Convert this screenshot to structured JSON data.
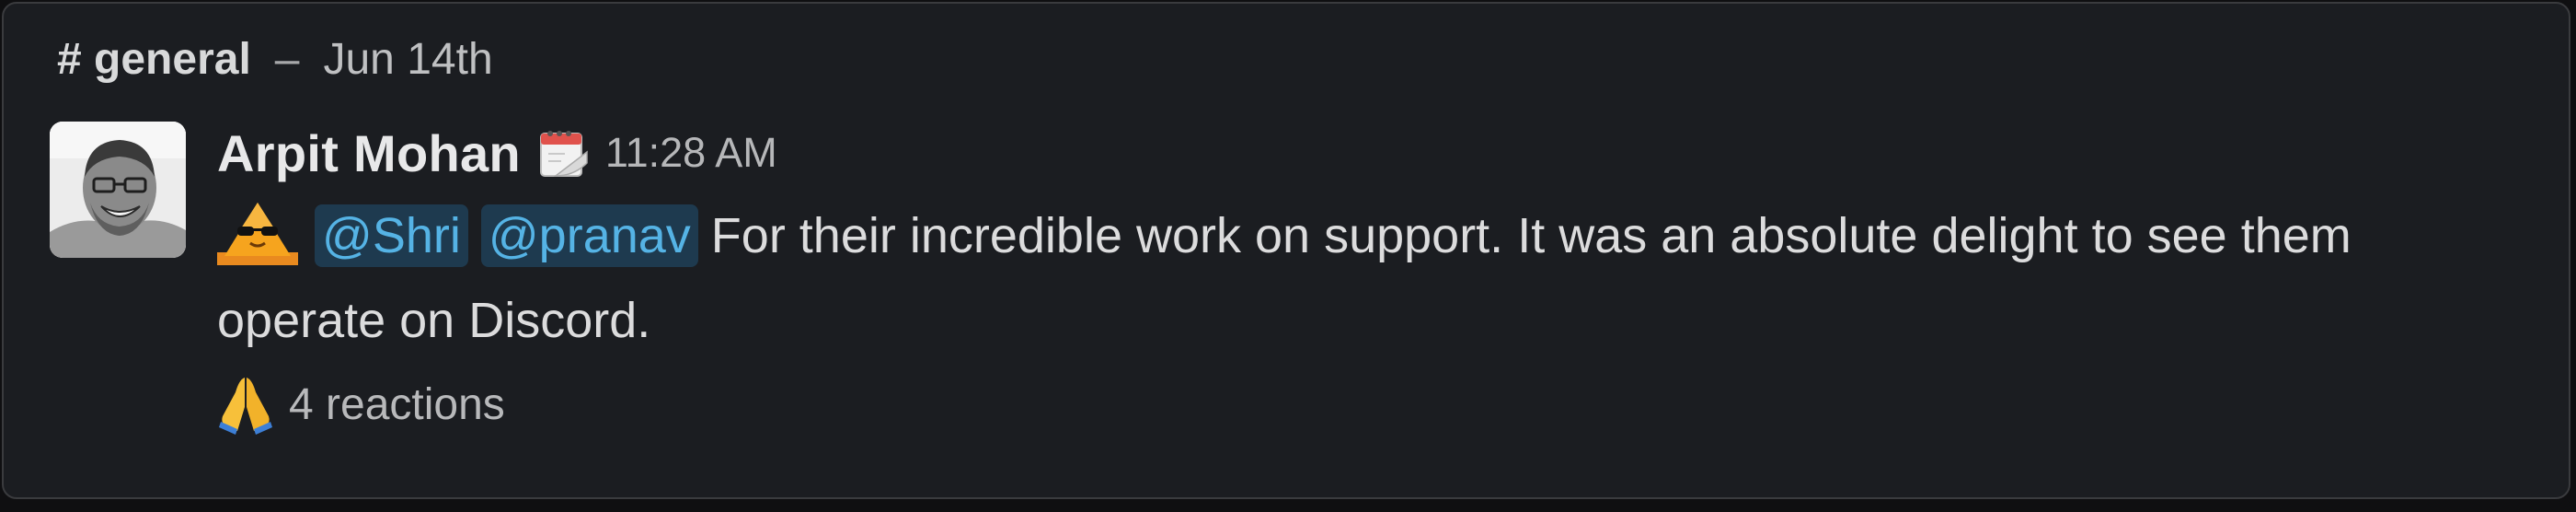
{
  "header": {
    "channel": "# general",
    "separator": "–",
    "date": "Jun 14th"
  },
  "message": {
    "author": "Arpit Mohan",
    "status_icon": "calendar-icon",
    "time": "11:28 AM",
    "custom_emoji": "party-cone-sunglasses-emoji",
    "mentions": [
      "@Shri",
      "@pranav"
    ],
    "text": "For their incredible work on support. It was an absolute delight to see them operate on Discord."
  },
  "reactions": {
    "emoji": "folded-hands-emoji",
    "label": "4 reactions"
  },
  "colors": {
    "background": "#1b1d21",
    "mention_bg": "#1e3a4f",
    "mention_text": "#55b3e5",
    "text": "#dcdcdd"
  }
}
